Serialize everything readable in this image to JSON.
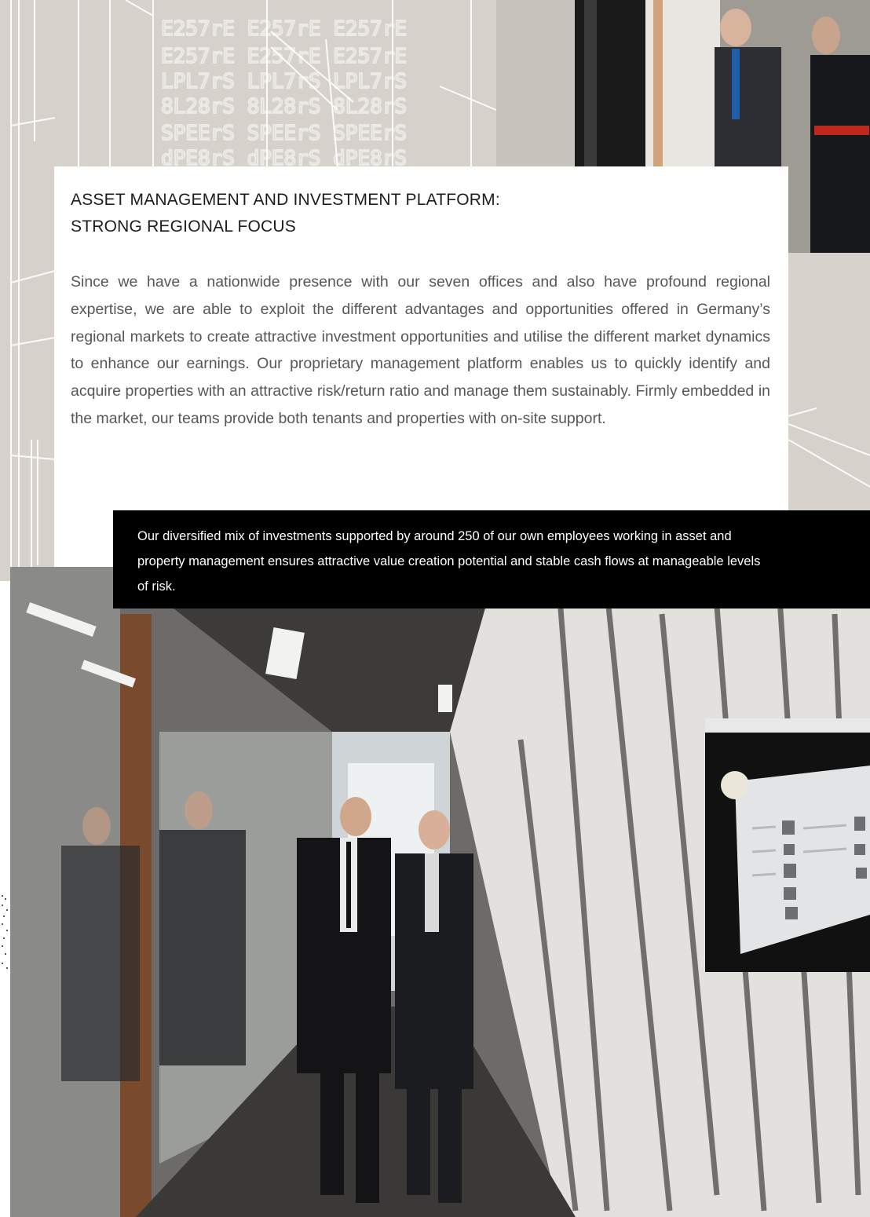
{
  "section": {
    "heading_lines": [
      "ASSET MANAGEMENT AND INVESTMENT PLATFORM:",
      "STRONG REGIONAL FOCUS"
    ],
    "body": "Since we have a nationwide presence with our seven offices and also have profound re­gional expertise, we are able to exploit the different advantages and opportunities offered in Germany’s regional markets to create attractive investment opportunities and utilise the different market dynamics to enhance our earnings. Our proprietary management platform enables us to quickly identify and acquire properties with an attractive risk/return ratio and manage them sustainably. Firmly embedded in the market, our teams provide both tenants and properties with on-site support."
  },
  "quote": {
    "text": "Our diversified mix of investments supported by around 250 of our own employees working in asset and property management ensures attractive value creation potential and stable cash flows at manageable levels of risk."
  },
  "colors": {
    "background_beige": "#d6d1ca",
    "heading": "#1d1d1b",
    "body_text": "#575756",
    "quote_bg": "#000000",
    "quote_text": "#ffffff"
  }
}
